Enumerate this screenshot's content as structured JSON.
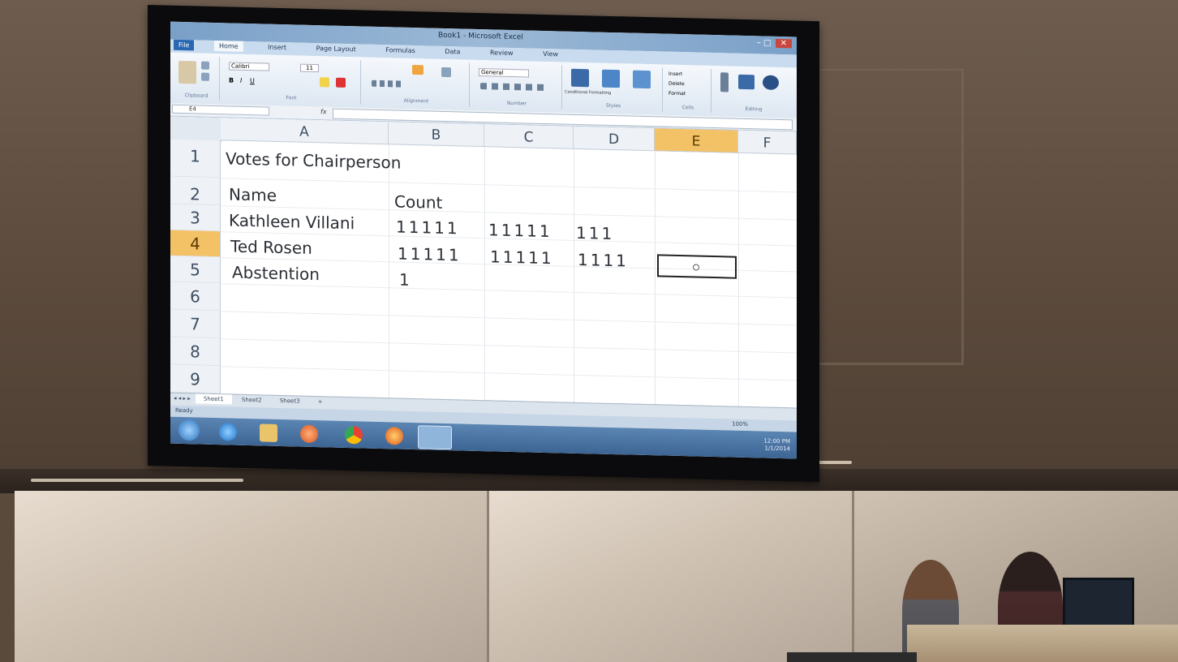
{
  "window": {
    "title": "Book1 - Microsoft Excel",
    "controls": {
      "minimize": "–",
      "maximize": "□",
      "close": "✕"
    }
  },
  "ribbon": {
    "tabs": [
      "File",
      "Home",
      "Insert",
      "Page Layout",
      "Formulas",
      "Data",
      "Review",
      "View"
    ],
    "groups": [
      "Clipboard",
      "Font",
      "Alignment",
      "Number",
      "Styles",
      "Cells",
      "Editing"
    ],
    "font_name": "Calibri",
    "font_size": "11",
    "number_format": "General",
    "styles_buttons": [
      "Conditional Formatting",
      "Format as Table",
      "Cell Styles"
    ],
    "cells_buttons": [
      "Insert",
      "Delete",
      "Format"
    ],
    "editing_buttons": [
      "Sort & Filter",
      "Find & Select"
    ]
  },
  "formula_bar": {
    "name_box": "E4",
    "fx": "fx",
    "value": ""
  },
  "grid": {
    "columns": [
      "A",
      "B",
      "C",
      "D",
      "E",
      "F"
    ],
    "active_column": "E",
    "rows": [
      "1",
      "2",
      "3",
      "4",
      "5",
      "6",
      "7",
      "8",
      "9"
    ],
    "active_row": "4",
    "cells": {
      "a1": "Votes for Chairperson",
      "a2": "Name",
      "b2": "Count",
      "a3": "Kathleen Villani",
      "b3": "11111",
      "c3": "11111",
      "d3": "111",
      "a4": "Ted Rosen",
      "b4": "11111",
      "c4": "11111",
      "d4": "1111",
      "a5": "Abstention",
      "b5": "1"
    }
  },
  "sheets": {
    "tabs": [
      "Sheet1",
      "Sheet2",
      "Sheet3"
    ],
    "active": "Sheet1"
  },
  "status": {
    "mode": "Ready",
    "zoom": "100%",
    "clock_time": "12:00 PM",
    "clock_date": "1/1/2014"
  },
  "colors": {
    "active_header": "#f3c166",
    "taskbar": "#3d6594",
    "file_tab": "#2a67b1"
  }
}
